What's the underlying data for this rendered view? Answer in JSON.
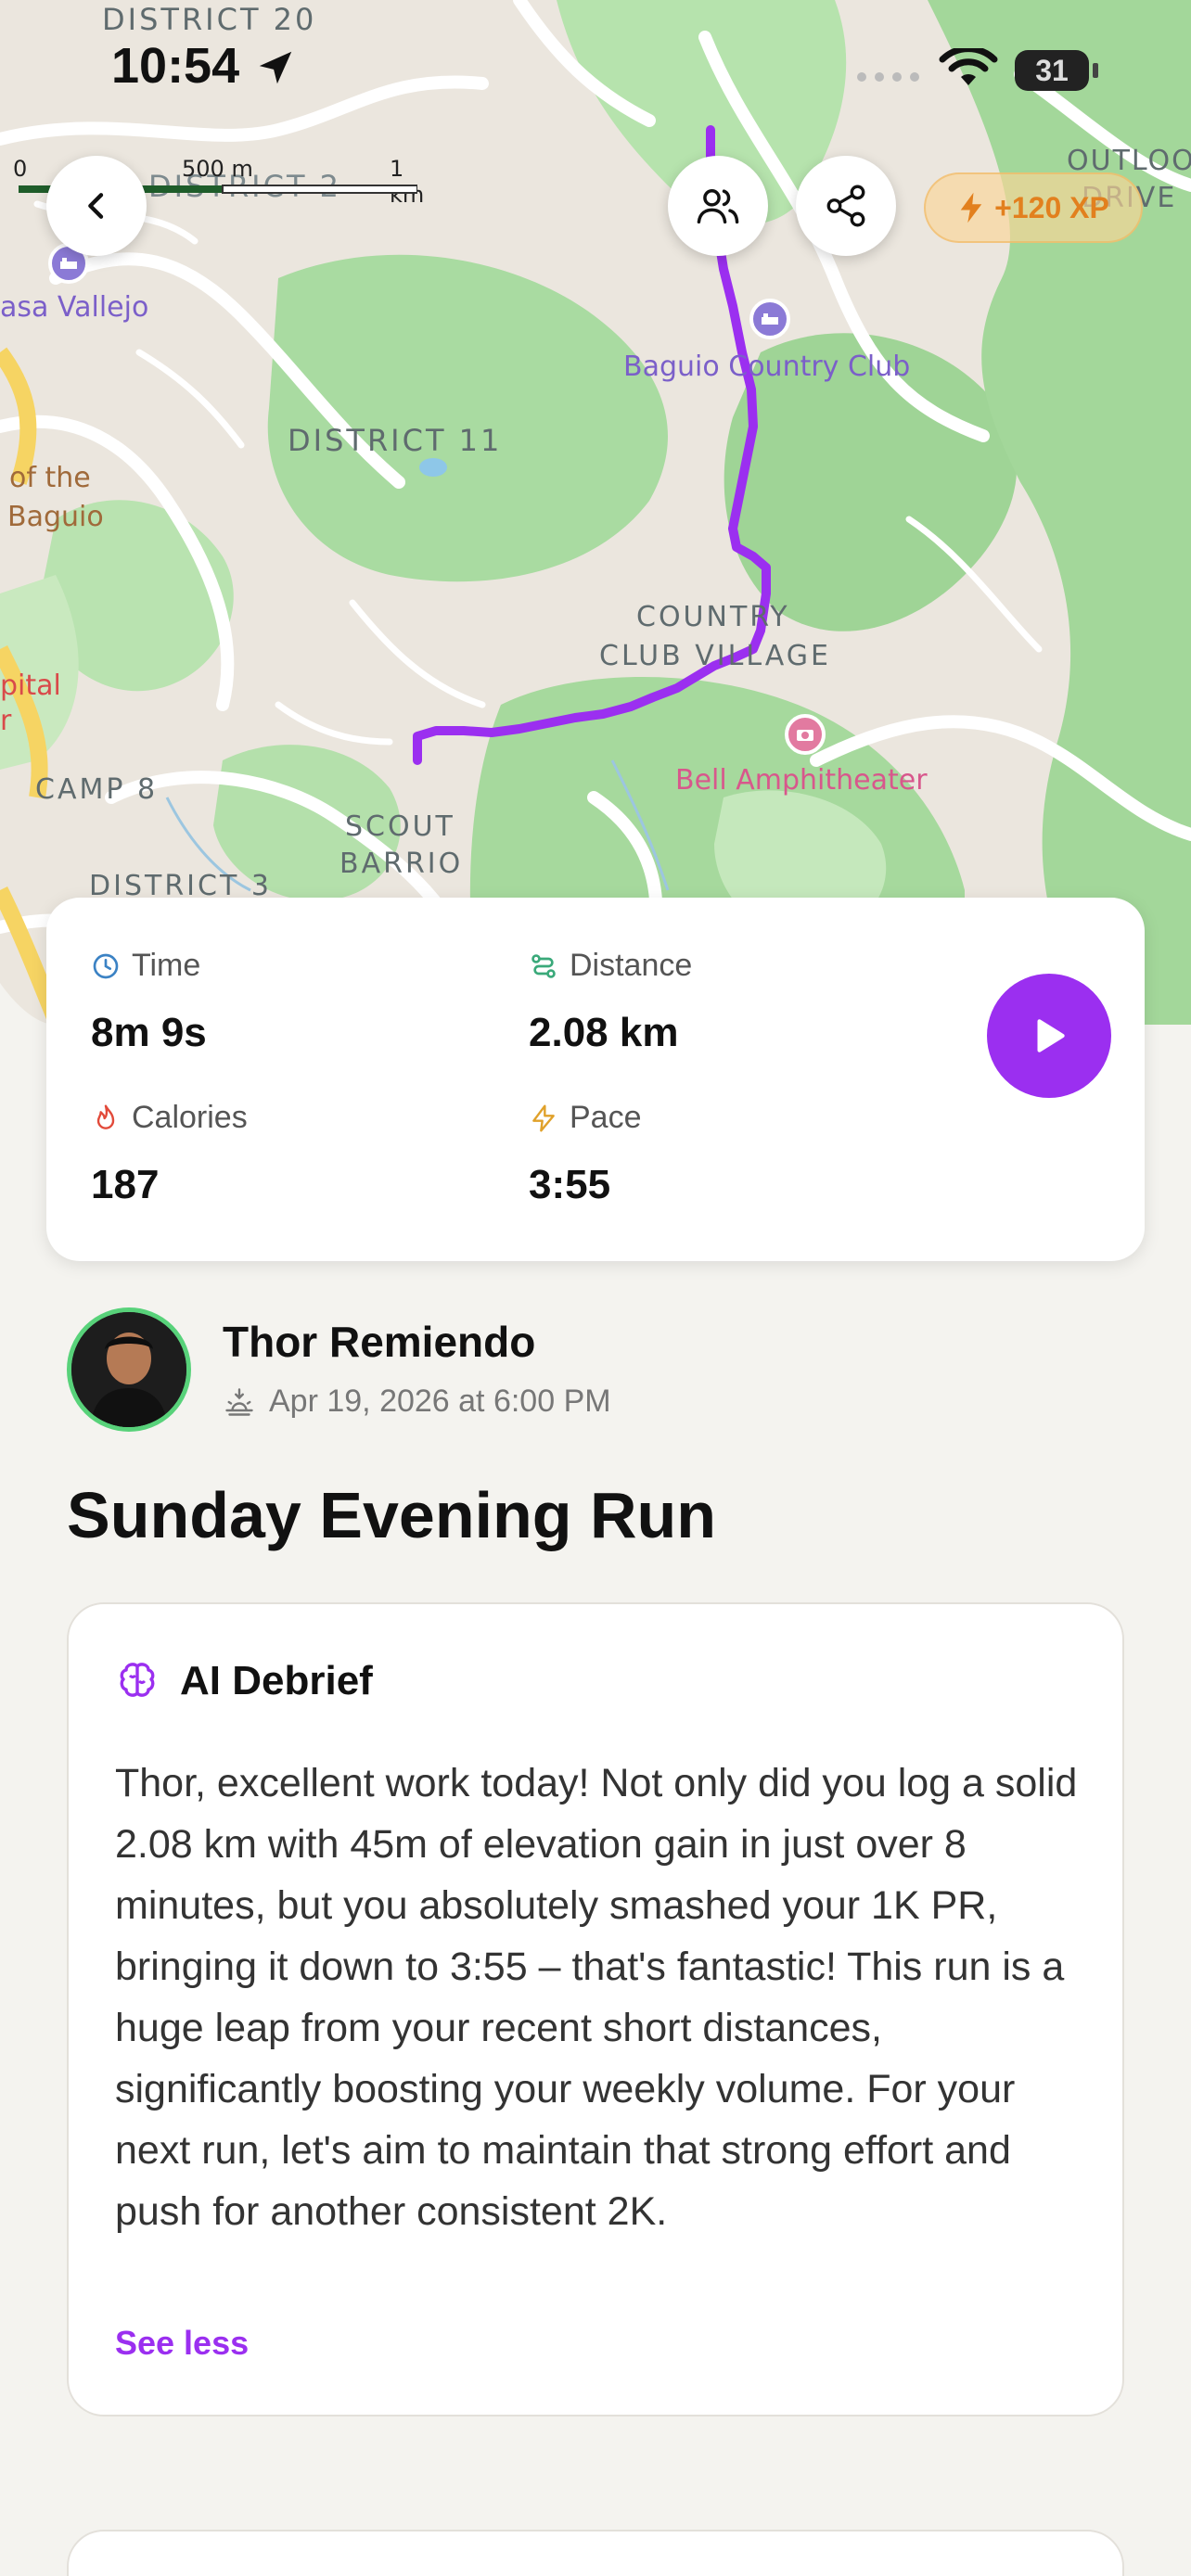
{
  "status_bar": {
    "time": "10:54",
    "battery": "31"
  },
  "map": {
    "scale": {
      "zero": "0",
      "mid": "500 m",
      "end": "1 km"
    },
    "areas": {
      "district_20": "DISTRICT 20",
      "district_2": "DISTRICT 2",
      "district_11": "DISTRICT 11",
      "country_club_village_1": "COUNTRY",
      "country_club_village_2": "CLUB VILLAGE",
      "camp_8": "CAMP 8",
      "scout_barrio_1": "SCOUT",
      "scout_barrio_2": "BARRIO",
      "district_3": "DISTRICT 3",
      "outlook_drive_1": "OUTLOO",
      "outlook_drive_2": "DRIVE"
    },
    "pois": {
      "casa_vallejo": "asa Vallejo",
      "baguio_country_club": "Baguio Country Club",
      "bell_amphitheater": "Bell Amphitheater",
      "of_the_baguio_1": "of the",
      "of_the_baguio_2": "Baguio",
      "hospital_1": "pital",
      "hospital_2": "r"
    },
    "xp_badge": "+120 XP"
  },
  "stats": {
    "time": {
      "label": "Time",
      "value": "8m 9s"
    },
    "distance": {
      "label": "Distance",
      "value": "2.08 km"
    },
    "calories": {
      "label": "Calories",
      "value": "187"
    },
    "pace": {
      "label": "Pace",
      "value": "3:55"
    }
  },
  "profile": {
    "name": "Thor Remiendo",
    "date": "Apr 19, 2026 at 6:00 PM"
  },
  "run_title": "Sunday Evening Run",
  "debrief": {
    "title": "AI Debrief",
    "body": "Thor, excellent work today! Not only did you log a solid 2.08 km with 45m of elevation gain in just over 8 minutes, but you absolutely smashed your 1K PR, bringing it down to 3:55 – that's fantastic! This run is a huge leap from your recent short distances, significantly boosting your weekly volume. For your next run, let's aim to maintain that strong effort and push for another consistent 2K.",
    "toggle": "See less"
  },
  "colors": {
    "accent": "#9b2ff0",
    "route": "#9b2ff0",
    "xp": "#e2801e",
    "avatar_ring": "#58d27a"
  }
}
